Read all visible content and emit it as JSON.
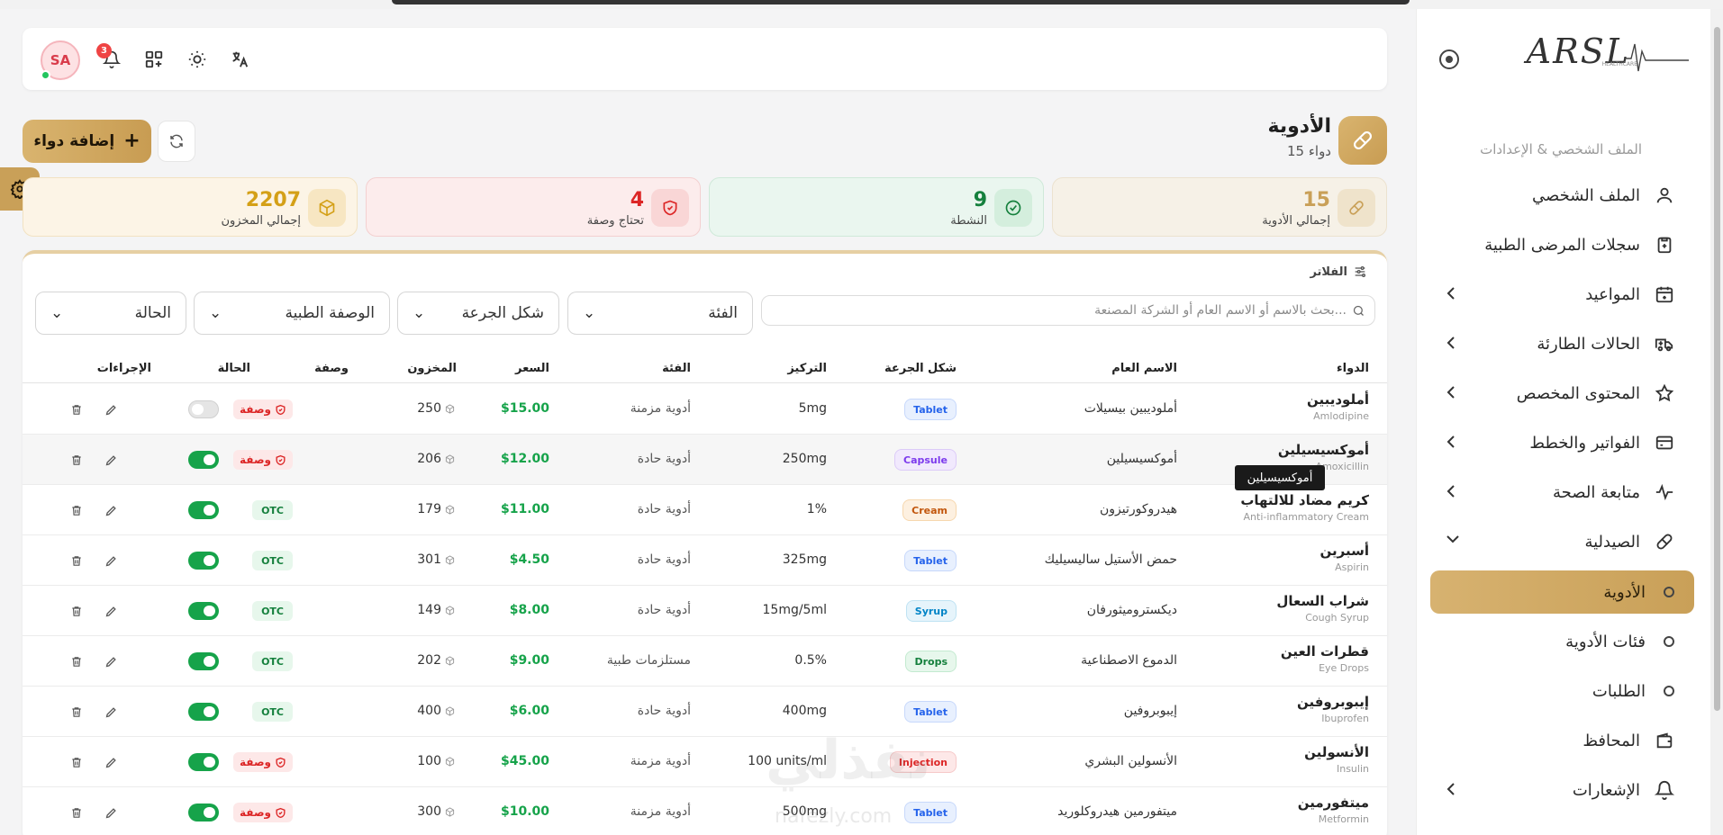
{
  "brand": {
    "logo": "ARSL",
    "tagline": "HEALTHCARE"
  },
  "sidebar": {
    "section_label": "الملف الشخصي & الإعدادات",
    "items": [
      {
        "label": "الملف الشخصي",
        "icon": "user-icon"
      },
      {
        "label": "سجلات المرضى الطبية",
        "icon": "clipboard-icon"
      },
      {
        "label": "المواعيد",
        "icon": "calendar-icon"
      },
      {
        "label": "الحالات الطارئة",
        "icon": "ambulance-icon"
      },
      {
        "label": "المحتوى المخصص",
        "icon": "star-icon"
      },
      {
        "label": "الفواتير والخطط",
        "icon": "credit-card-icon"
      },
      {
        "label": "متابعة الصحة",
        "icon": "pulse-icon"
      },
      {
        "label": "الصيدلية",
        "icon": "pill-icon"
      },
      {
        "label": "الأدوية",
        "icon": "circle-icon"
      },
      {
        "label": "فئات الأدوية",
        "icon": "circle-icon"
      },
      {
        "label": "الطلبات",
        "icon": "circle-icon"
      },
      {
        "label": "المحافظ",
        "icon": "wallet-icon"
      },
      {
        "label": "الإشعارات",
        "icon": "bell-icon"
      }
    ]
  },
  "topbar": {
    "avatar_initials": "SA",
    "notification_count": "3"
  },
  "header": {
    "title": "الأدوية",
    "subtitle": "15 دواء",
    "add_button": "إضافة دواء"
  },
  "stats": [
    {
      "value": "15",
      "label": "إجمالي الأدوية",
      "color": "#c9a058"
    },
    {
      "value": "9",
      "label": "النشطة",
      "color": "#15803d"
    },
    {
      "value": "4",
      "label": "تحتاج وصفة",
      "color": "#dc2626"
    },
    {
      "value": "2207",
      "label": "إجمالي المخزون",
      "color": "#d4a017"
    }
  ],
  "filters": {
    "label": "الفلاتر",
    "search_placeholder": "بحث بالاسم أو الاسم العام أو الشركة المصنعة...",
    "category": "الفئة",
    "form": "شكل الجرعة",
    "prescription": "الوصفة الطبية",
    "status": "الحالة"
  },
  "table": {
    "headers": {
      "drug": "الدواء",
      "generic": "الاسم العام",
      "form": "شكل الجرعة",
      "strength": "التركيز",
      "category": "الفئة",
      "price": "السعر",
      "stock": "المخزون",
      "prescription": "وصفة",
      "status": "الحالة",
      "actions": "الإجراءات"
    },
    "rx_label": "وصفة",
    "otc_label": "OTC",
    "rows": [
      {
        "name": "أملوديبين",
        "en": "Amlodipine",
        "generic": "أملوديبين بيسيلات",
        "form": "Tablet",
        "strength": "5mg",
        "category": "أدوية مزمنة",
        "price": "$15.00",
        "stock": "250",
        "rx": true,
        "active": false
      },
      {
        "name": "أموكسيسيلين",
        "en": "Amoxicillin",
        "generic": "أموكسيسيلين",
        "form": "Capsule",
        "strength": "250mg",
        "category": "أدوية حادة",
        "price": "$12.00",
        "stock": "206",
        "rx": true,
        "active": true
      },
      {
        "name": "كريم مضاد للالتهاب",
        "en": "Anti-inflammatory Cream",
        "generic": "هيدروكورتيزون",
        "form": "Cream",
        "strength": "1%",
        "category": "أدوية حادة",
        "price": "$11.00",
        "stock": "179",
        "rx": false,
        "active": true
      },
      {
        "name": "أسبرين",
        "en": "Aspirin",
        "generic": "حمض الأستيل ساليسيليك",
        "form": "Tablet",
        "strength": "325mg",
        "category": "أدوية حادة",
        "price": "$4.50",
        "stock": "301",
        "rx": false,
        "active": true
      },
      {
        "name": "شراب السعال",
        "en": "Cough Syrup",
        "generic": "ديكستروميثورفان",
        "form": "Syrup",
        "strength": "15mg/5ml",
        "category": "أدوية حادة",
        "price": "$8.00",
        "stock": "149",
        "rx": false,
        "active": true
      },
      {
        "name": "قطرات العين",
        "en": "Eye Drops",
        "generic": "الدموع الاصطناعية",
        "form": "Drops",
        "strength": "0.5%",
        "category": "مستلزمات طبية",
        "price": "$9.00",
        "stock": "202",
        "rx": false,
        "active": true
      },
      {
        "name": "إيبوبروفين",
        "en": "Ibuprofen",
        "generic": "إيبوبروفين",
        "form": "Tablet",
        "strength": "400mg",
        "category": "أدوية حادة",
        "price": "$6.00",
        "stock": "400",
        "rx": false,
        "active": true
      },
      {
        "name": "الأنسولين",
        "en": "Insulin",
        "generic": "الأنسولين البشري",
        "form": "Injection",
        "strength": "100 units/ml",
        "category": "أدوية مزمنة",
        "price": "$45.00",
        "stock": "100",
        "rx": true,
        "active": true
      },
      {
        "name": "ميتفورمين",
        "en": "Metformin",
        "generic": "ميتفورمين هيدروكلوريد",
        "form": "Tablet",
        "strength": "500mg",
        "category": "أدوية مزمنة",
        "price": "$10.00",
        "stock": "300",
        "rx": true,
        "active": true
      }
    ]
  },
  "tooltip": "أموكسيسيلين",
  "watermark": {
    "text": "نفذلي",
    "url": "nafezly.com"
  }
}
